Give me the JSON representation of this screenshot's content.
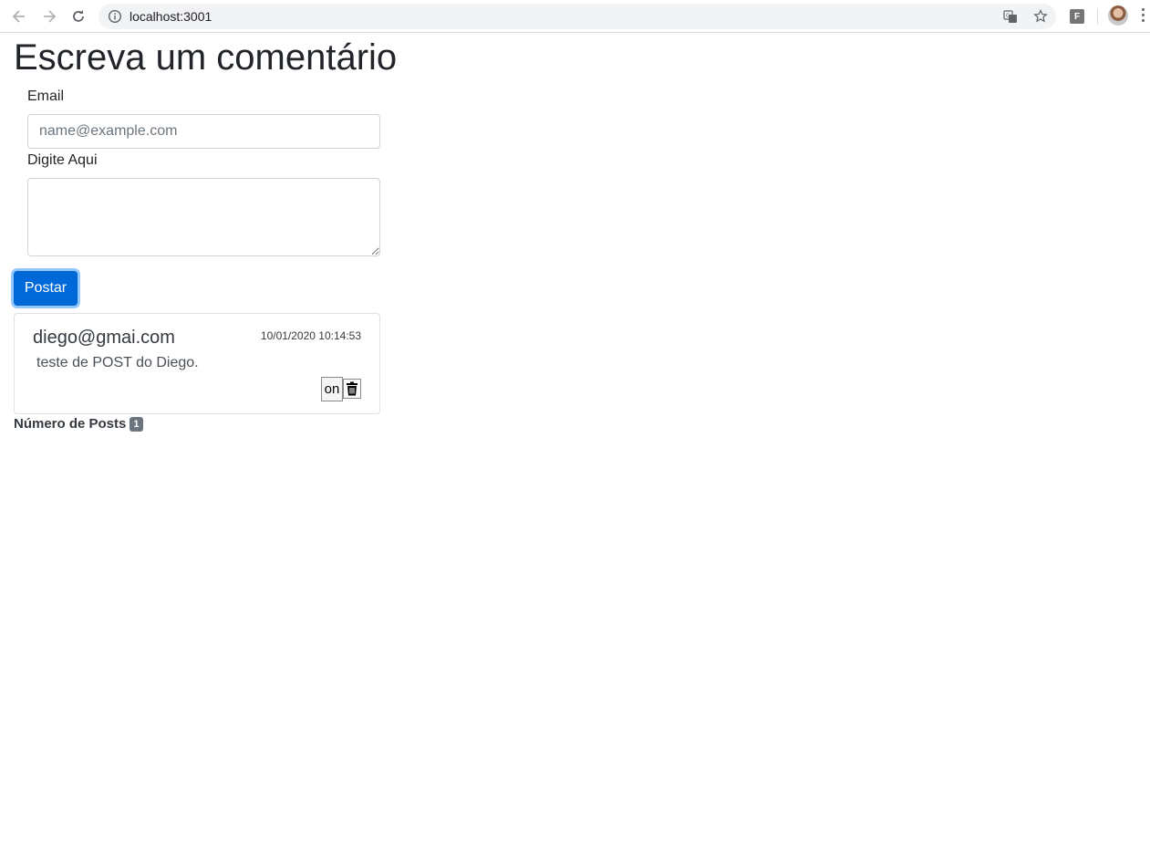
{
  "browser": {
    "url": "localhost:3001",
    "extension_letter": "F"
  },
  "page": {
    "title": "Escreva um comentário",
    "email_label": "Email",
    "email_placeholder": "name@example.com",
    "email_value": "",
    "message_label": "Digite Aqui",
    "message_value": "",
    "post_button": "Postar"
  },
  "posts": [
    {
      "email": "diego@gmai.com",
      "date": "10/01/2020 10:14:53",
      "text": "teste de POST do Diego.",
      "toggle_label": "on"
    }
  ],
  "footer": {
    "count_label": "Número de Posts",
    "count": "1"
  },
  "colors": {
    "primary": "#0069d9",
    "badge": "#6c757d"
  }
}
